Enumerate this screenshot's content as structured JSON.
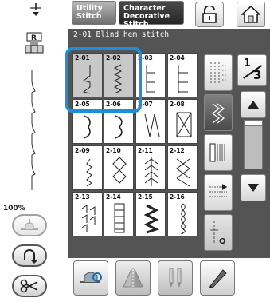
{
  "tabs": {
    "utility": "Utility Stitch",
    "character": "Character Decorative Stitch"
  },
  "panel": {
    "title": "2-01 Blind hem stitch"
  },
  "zoom": "100%",
  "page": {
    "current": "1",
    "total": "3"
  },
  "stitches": [
    {
      "num": "2-01"
    },
    {
      "num": "2-02"
    },
    {
      "num": "2-03"
    },
    {
      "num": "2-04"
    },
    {
      "num": "2-05"
    },
    {
      "num": "2-06"
    },
    {
      "num": "2-07"
    },
    {
      "num": "2-08"
    },
    {
      "num": "2-09"
    },
    {
      "num": "2-10"
    },
    {
      "num": "2-11"
    },
    {
      "num": "2-12"
    },
    {
      "num": "2-13"
    },
    {
      "num": "2-14"
    },
    {
      "num": "2-15"
    },
    {
      "num": "2-16"
    }
  ],
  "selected_stitch": "2-01",
  "side_buttons": {
    "q_label": "Q"
  },
  "colors": {
    "selection": "#1e8fd6",
    "panel": "#545454",
    "active_tab": "#2a2a2a"
  },
  "icons": [
    "needle-position-icon",
    "presser-foot-icon",
    "stitch-preview-icon",
    "key-icon",
    "home-icon",
    "needle-mode-icon",
    "thread-cutter-icon",
    "reverse-stitch-icon",
    "scissors-icon",
    "pivot-icon",
    "mirror-icon",
    "twin-needle-icon",
    "pencil-icon"
  ]
}
